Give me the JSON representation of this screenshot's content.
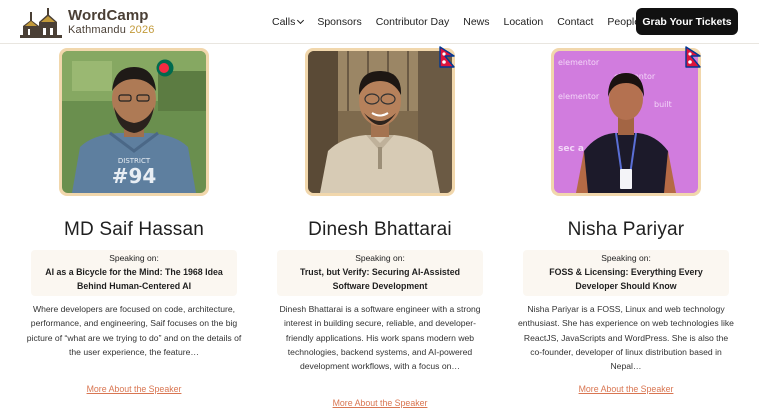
{
  "header": {
    "logo_name": "WordCamp",
    "logo_city": "Kathmandu",
    "logo_year": "2026",
    "nav": [
      {
        "label": "Calls",
        "dropdown": true
      },
      {
        "label": "Sponsors",
        "dropdown": false
      },
      {
        "label": "Contributor Day",
        "dropdown": false
      },
      {
        "label": "News",
        "dropdown": false
      },
      {
        "label": "Location",
        "dropdown": false
      },
      {
        "label": "Contact",
        "dropdown": false
      },
      {
        "label": "People",
        "dropdown": true
      }
    ],
    "cta_label": "Grab Your Tickets"
  },
  "speakers": [
    {
      "name": "MD Saif Hassan",
      "speaking_on": "Speaking on:",
      "talk": "AI as a Bicycle for the Mind: The 1968 Idea Behind Human-Centered AI",
      "bio": "Where developers are focused on code, architecture, performance, and engineering, Saif focuses on the big picture of “what are we trying to do” and on the details of the user experience, the feature…",
      "more": "More About the Speaker",
      "flag": "bangladesh-flag",
      "shirt_text": "DISTRICT #94"
    },
    {
      "name": "Dinesh Bhattarai",
      "speaking_on": "Speaking on:",
      "talk": "Trust, but Verify: Securing AI-Assisted Software Development",
      "bio": "Dinesh Bhattarai is a software engineer with a strong interest in building secure, reliable, and developer-friendly applications. His work spans modern web technologies, backend systems, and AI-powered development workflows, with a focus on…",
      "more": "More About the Speaker",
      "flag": "nepal-flag"
    },
    {
      "name": "Nisha Pariyar",
      "speaking_on": "Speaking on:",
      "talk": "FOSS & Licensing: Everything Every Developer Should Know",
      "bio": "Nisha Pariyar is a FOSS, Linux and web technology enthusiast. She has experience on web technologies like ReactJS, JavaScripts and WordPress. She is also the co-founder, developer of linux distribution based in Nepal…",
      "more": "More About the Speaker",
      "flag": "nepal-flag",
      "backdrop_text": "elementor"
    }
  ],
  "colors": {
    "accent_link": "#d97652",
    "cta_bg": "#111111",
    "logo_brown": "#4a3f35",
    "logo_gold": "#c29a3a",
    "talk_box_bg": "#fbf7f1",
    "photo_border": "#f1d7ac"
  }
}
